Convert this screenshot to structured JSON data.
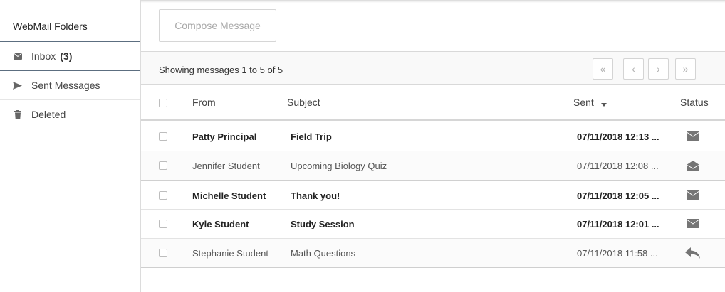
{
  "sidebar": {
    "title": "WebMail Folders",
    "items": [
      {
        "label": "Inbox",
        "count": "(3)",
        "icon": "envelope-icon"
      },
      {
        "label": "Sent Messages",
        "icon": "send-icon"
      },
      {
        "label": "Deleted",
        "icon": "trash-icon"
      }
    ]
  },
  "toolbar": {
    "compose_label": "Compose Message"
  },
  "pager": {
    "summary": "Showing messages 1 to 5 of 5",
    "first": "«",
    "prev": "‹",
    "next": "›",
    "last": "»"
  },
  "table": {
    "headers": {
      "from": "From",
      "subject": "Subject",
      "sent": "Sent",
      "status": "Status"
    },
    "rows": [
      {
        "from": "Patty Principal",
        "subject": "Field Trip",
        "sent": "07/11/2018 12:13 ...",
        "status": "unread-envelope-icon",
        "unread": true
      },
      {
        "from": "Jennifer Student",
        "subject": "Upcoming Biology Quiz",
        "sent": "07/11/2018 12:08 ...",
        "status": "opened-envelope-icon",
        "unread": false
      },
      {
        "from": "Michelle Student",
        "subject": "Thank you!",
        "sent": "07/11/2018 12:05 ...",
        "status": "unread-envelope-icon",
        "unread": true
      },
      {
        "from": "Kyle Student",
        "subject": "Study Session",
        "sent": "07/11/2018 12:01 ...",
        "status": "unread-envelope-icon",
        "unread": true
      },
      {
        "from": "Stephanie Student",
        "subject": "Math Questions",
        "sent": "07/11/2018 11:58 ...",
        "status": "reply-icon",
        "unread": false
      }
    ]
  },
  "colors": {
    "accent_border": "#5c6e80",
    "icon_gray": "#757575"
  }
}
